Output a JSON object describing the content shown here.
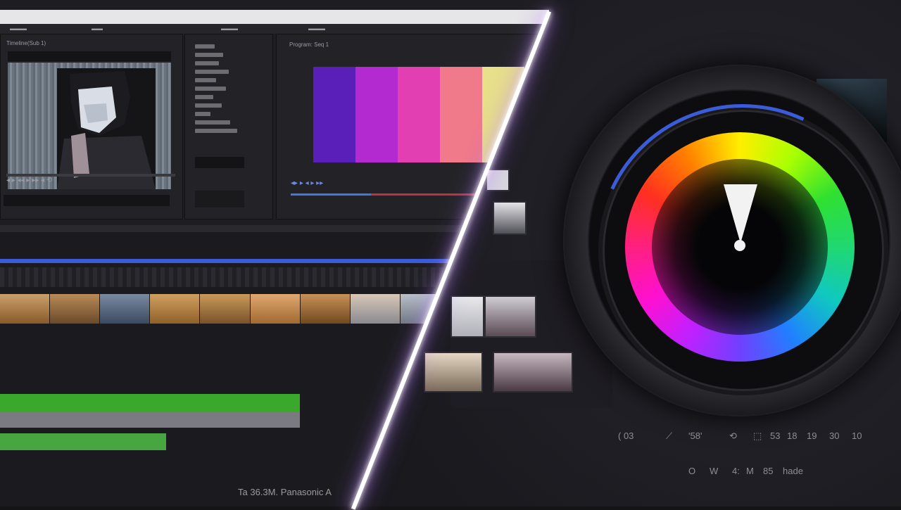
{
  "left_app": {
    "source_monitor_label": "Timeline(Sub 1)",
    "program_monitor_label": "Program: Seq 1",
    "status_text": "Ta  36.3M. Panasonic A",
    "test_pattern_colors": [
      "#5a1fb8",
      "#b22ad0",
      "#e23fb2",
      "#f07a8a",
      "#e8e08a"
    ]
  },
  "right_app": {
    "toolbar_items": [
      "( 03",
      "⟋",
      "'58'",
      "⟲",
      "⬚",
      "53",
      "18",
      "19",
      "30",
      "10"
    ],
    "bottom_row_items": [
      "O",
      "W",
      "4:",
      "M",
      "85",
      "hade"
    ]
  },
  "colors": {
    "accent_blue": "#3a5cd8",
    "glow": "#d9b0ff",
    "panel_bg": "#1e1e22"
  }
}
